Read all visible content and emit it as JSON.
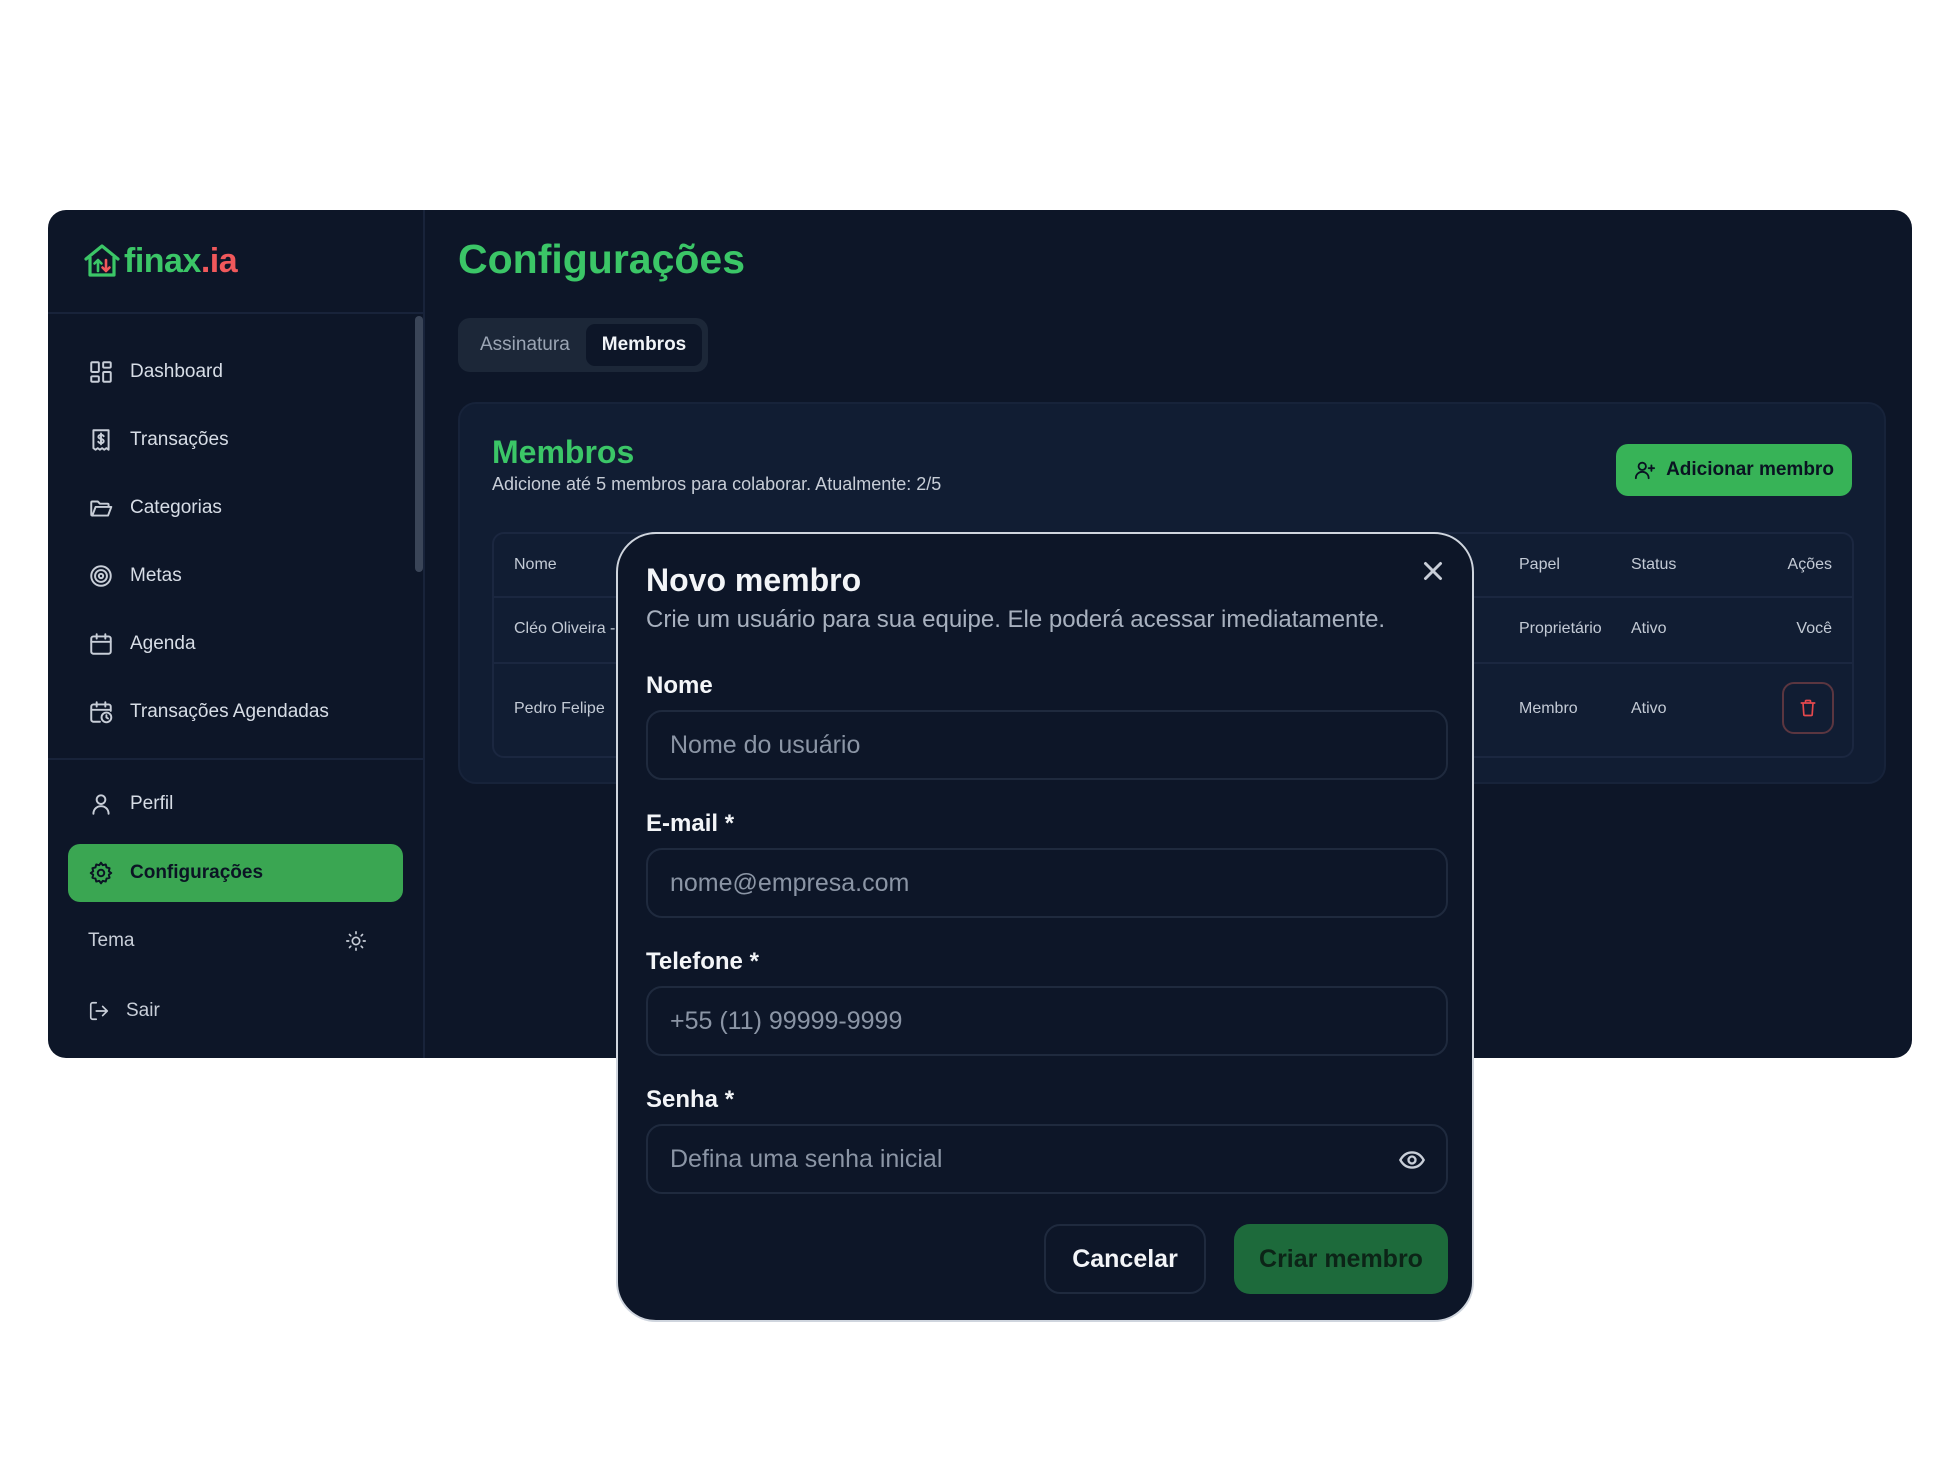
{
  "brand": {
    "name_part1": "finax",
    "name_part2": ".ia",
    "primary_color": "#3bc667",
    "accent_color": "#f0585b"
  },
  "sidebar": {
    "items": [
      {
        "label": "Dashboard",
        "icon": "dashboard-icon"
      },
      {
        "label": "Transações",
        "icon": "dollar-receipt-icon"
      },
      {
        "label": "Categorias",
        "icon": "folder-icon"
      },
      {
        "label": "Metas",
        "icon": "target-icon"
      },
      {
        "label": "Agenda",
        "icon": "calendar-icon"
      },
      {
        "label": "Transações Agendadas",
        "icon": "calendar-clock-icon"
      }
    ],
    "profile_label": "Perfil",
    "settings_label": "Configurações",
    "theme_label": "Tema",
    "logout_label": "Sair"
  },
  "header": {
    "title": "Configurações",
    "tabs": [
      {
        "label": "Assinatura",
        "active": false
      },
      {
        "label": "Membros",
        "active": true
      }
    ]
  },
  "members": {
    "title": "Membros",
    "subtitle": "Adicione até 5 membros para colaborar. Atualmente: 2/5",
    "add_button": "Adicionar membro",
    "columns": {
      "name": "Nome",
      "role": "Papel",
      "status": "Status",
      "actions": "Ações"
    },
    "rows": [
      {
        "name": "Cléo Oliveira -",
        "role": "Proprietário",
        "status": "Ativo",
        "action": "Você"
      },
      {
        "name": "Pedro Felipe",
        "role": "Membro",
        "status": "Ativo",
        "action": ""
      }
    ]
  },
  "modal": {
    "title": "Novo membro",
    "subtitle": "Crie um usuário para sua equipe. Ele poderá acessar imediatamente.",
    "fields": {
      "name": {
        "label": "Nome",
        "placeholder": "Nome do usuário"
      },
      "email": {
        "label": "E-mail *",
        "placeholder": "nome@empresa.com"
      },
      "phone": {
        "label": "Telefone *",
        "placeholder": "+55 (11) 99999-9999"
      },
      "password": {
        "label": "Senha *",
        "placeholder": "Defina uma senha inicial"
      }
    },
    "cancel_button": "Cancelar",
    "submit_button": "Criar membro"
  }
}
